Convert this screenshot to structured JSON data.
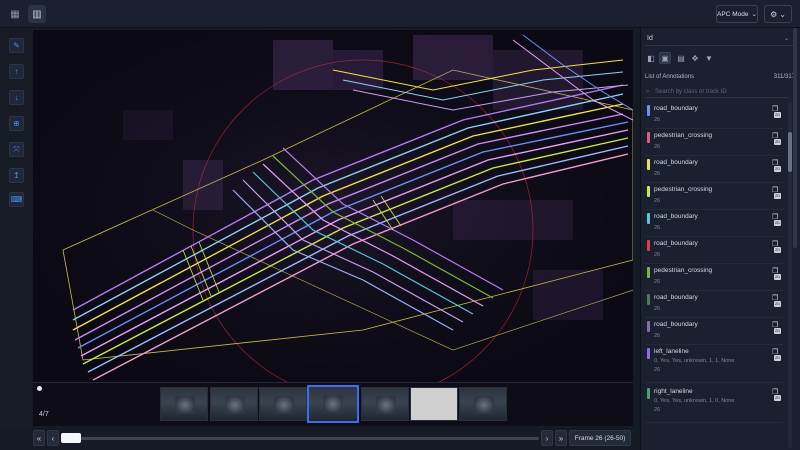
{
  "topbar": {
    "tool_icons": [
      "layers-icon",
      "grid-icon"
    ],
    "mode_label": "APC Mode",
    "mode_chevron": "⌄",
    "settings_glyph": "⚙",
    "settings_chevron": "⌄"
  },
  "left_tools": [
    "pen-icon",
    "arrow-up-icon",
    "arrow-down-icon",
    "zoom-icon",
    "expand-icon",
    "info-icon",
    "keyboard-icon"
  ],
  "filmstrip": {
    "frame_count": "4/7",
    "selected_index": 3,
    "blank_index": 5,
    "thumb_count": 7
  },
  "bottom": {
    "first_glyph": "«",
    "prev_glyph": "‹",
    "next_glyph": "›",
    "last_glyph": "»",
    "frame_label": "Frame 26 (26-50)"
  },
  "panel": {
    "id_select": "Id",
    "list_title": "List of Annotations",
    "list_count": "311/317",
    "search_placeholder": "Search by class or track ID",
    "annotations": [
      {
        "name": "road_boundary",
        "sub": "26",
        "color": "#6f8ff7"
      },
      {
        "name": "pedestrian_crossing",
        "sub": "26",
        "color": "#e45a86"
      },
      {
        "name": "road_boundary",
        "sub": "26",
        "color": "#f2e24a"
      },
      {
        "name": "pedestrian_crossing",
        "sub": "26",
        "color": "#cbe84a"
      },
      {
        "name": "road_boundary",
        "sub": "26",
        "color": "#55c7dc"
      },
      {
        "name": "road_boundary",
        "sub": "26",
        "color": "#e53a4a"
      },
      {
        "name": "pedestrian_crossing",
        "sub": "26",
        "color": "#7fb536"
      },
      {
        "name": "road_boundary",
        "sub": "26",
        "color": "#4d7a5a"
      },
      {
        "name": "road_boundary",
        "sub": "26",
        "color": "#8a6aa6"
      },
      {
        "name": "left_laneline",
        "sub": "0, Yes, Yes, unknown, 1, 1, None",
        "sub2": "26",
        "color": "#8a6af2"
      },
      {
        "name": "right_laneline",
        "sub": "0, Yes, Yes, unknown, 1, 0, None",
        "sub2": "26",
        "color": "#4aa35c"
      }
    ]
  }
}
